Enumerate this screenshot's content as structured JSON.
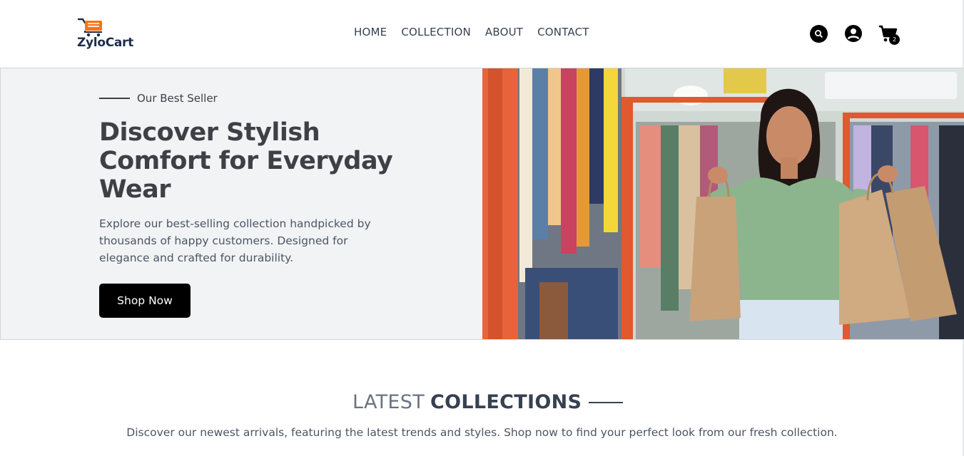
{
  "brand": {
    "name": "ZyloCart",
    "accent_color": "#f97316",
    "dark_color": "#1f2d4a"
  },
  "nav": {
    "items": [
      {
        "label": "HOME"
      },
      {
        "label": "COLLECTION"
      },
      {
        "label": "ABOUT"
      },
      {
        "label": "CONTACT"
      }
    ]
  },
  "header_icons": {
    "search": "search-icon",
    "account": "user-icon",
    "cart": "cart-icon",
    "cart_count": "2"
  },
  "hero": {
    "eyebrow": "Our Best Seller",
    "title": "Discover Stylish Comfort for Everyday Wear",
    "description": "Explore our best-selling collection handpicked by thousands of happy customers. Designed for elegance and crafted for durability.",
    "button_label": "Shop Now",
    "image_alt": "woman-holding-shopping-bags-in-clothing-store"
  },
  "latest": {
    "title_light": "LATEST",
    "title_bold": "COLLECTIONS",
    "description": "Discover our newest arrivals, featuring the latest trends and styles. Shop now to find your perfect look from our fresh collection."
  }
}
